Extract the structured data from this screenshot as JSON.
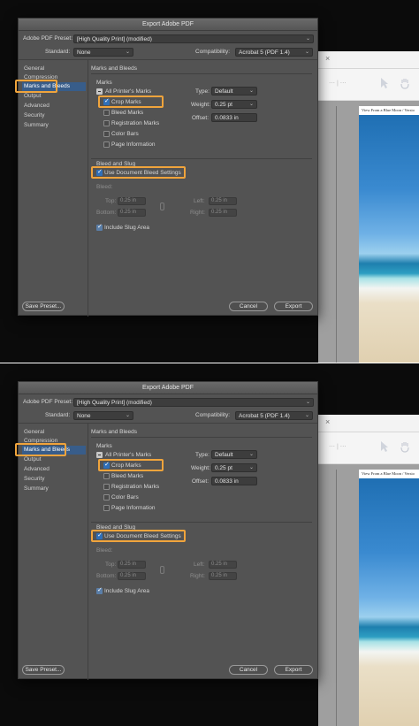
{
  "dialog": {
    "title": "Export Adobe PDF",
    "preset_label": "Adobe PDF Preset:",
    "preset_value": "[High Quality Print] (modified)",
    "standard_label": "Standard:",
    "standard_value": "None",
    "compat_label": "Compatibility:",
    "compat_value": "Acrobat 5 (PDF 1.4)"
  },
  "sidebar": {
    "items": [
      {
        "label": "General"
      },
      {
        "label": "Compression"
      },
      {
        "label": "Marks and Bleeds"
      },
      {
        "label": "Output"
      },
      {
        "label": "Advanced"
      },
      {
        "label": "Security"
      },
      {
        "label": "Summary"
      }
    ],
    "active_index": 2
  },
  "section": {
    "heading": "Marks and Bleeds",
    "marks_group": "Marks",
    "all_printers_marks": "All Printer's Marks",
    "crop_marks": "Crop Marks",
    "bleed_marks": "Bleed Marks",
    "registration_marks": "Registration Marks",
    "color_bars": "Color Bars",
    "page_information": "Page Information",
    "type_label": "Type:",
    "type_value": "Default",
    "weight_label": "Weight:",
    "weight_value": "0.25 pt",
    "offset_label": "Offset:",
    "offset_value": "0.0833 in",
    "bleed_slug_group": "Bleed and Slug",
    "use_doc_bleed": "Use Document Bleed Settings",
    "bleed_label": "Bleed:",
    "top_label": "Top:",
    "bottom_label": "Bottom:",
    "left_label": "Left:",
    "right_label": "Right:",
    "bleed_value": "0.25 in",
    "include_slug": "Include Slug Area"
  },
  "buttons": {
    "save_preset": "Save Preset...",
    "cancel": "Cancel",
    "export": "Export"
  },
  "document": {
    "caption": "View From a Blue Moon / Versio"
  },
  "colors": {
    "highlight": "#f0a43c",
    "dialog_bg": "#535353",
    "selection": "#385d8a"
  }
}
